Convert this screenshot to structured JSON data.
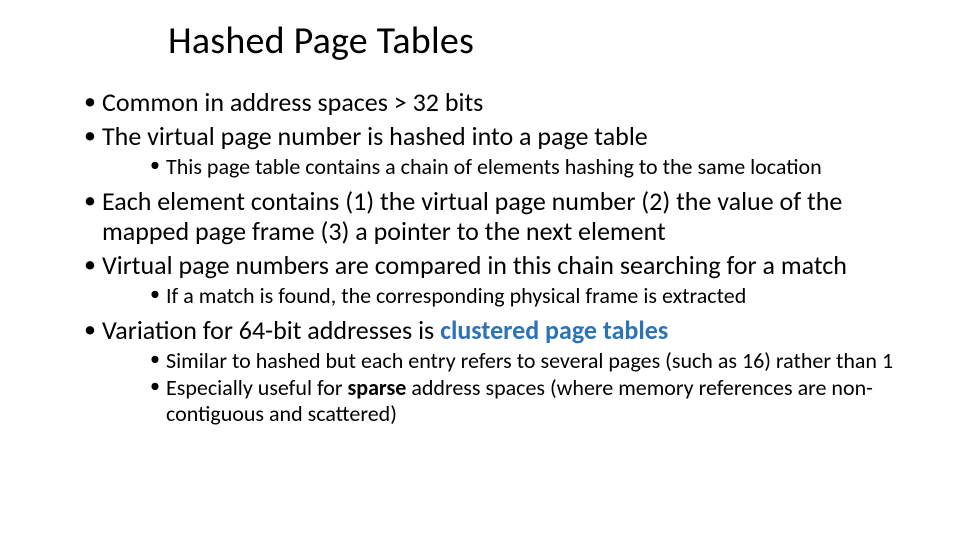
{
  "title": "Hashed Page Tables",
  "bullets": {
    "b1": "Common in address spaces > 32 bits",
    "b2": "The virtual page number is hashed into a page table",
    "b2_1": "This page table contains a chain of elements hashing to the same location",
    "b3": "Each element contains (1) the virtual page number (2) the value of the mapped page frame (3) a pointer to the next element",
    "b4": "Virtual page numbers are compared in this chain searching for a match",
    "b4_1": "If a match is found, the corresponding physical frame is extracted",
    "b5_pre": "Variation for 64-bit addresses is ",
    "b5_term": "clustered page tables",
    "b5_1": "Similar to hashed but each entry refers to several pages (such as 16) rather than 1",
    "b5_2_pre": "Especially useful for ",
    "b5_2_bold": "sparse",
    "b5_2_post": " address spaces (where memory references are non-contiguous and scattered)"
  }
}
